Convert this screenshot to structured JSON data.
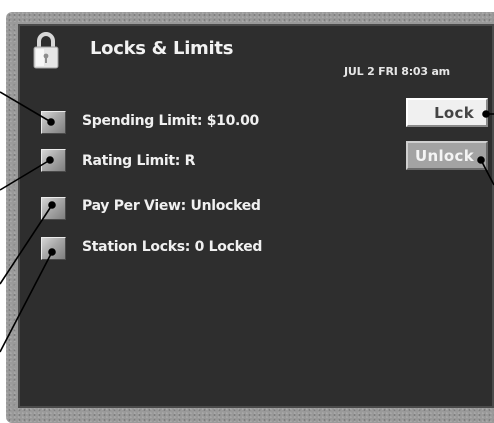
{
  "header": {
    "title": "Locks & Limits",
    "datetime": "JUL 2 FRI 8:03 am"
  },
  "rows": [
    {
      "label": "Spending Limit: $10.00"
    },
    {
      "label": "Rating Limit: R"
    },
    {
      "label": "Pay Per View: Unlocked"
    },
    {
      "label": "Station Locks: 0 Locked"
    }
  ],
  "buttons": {
    "lock": "Lock",
    "unlock": "Unlock"
  },
  "icons": {
    "header": "padlock-icon"
  }
}
